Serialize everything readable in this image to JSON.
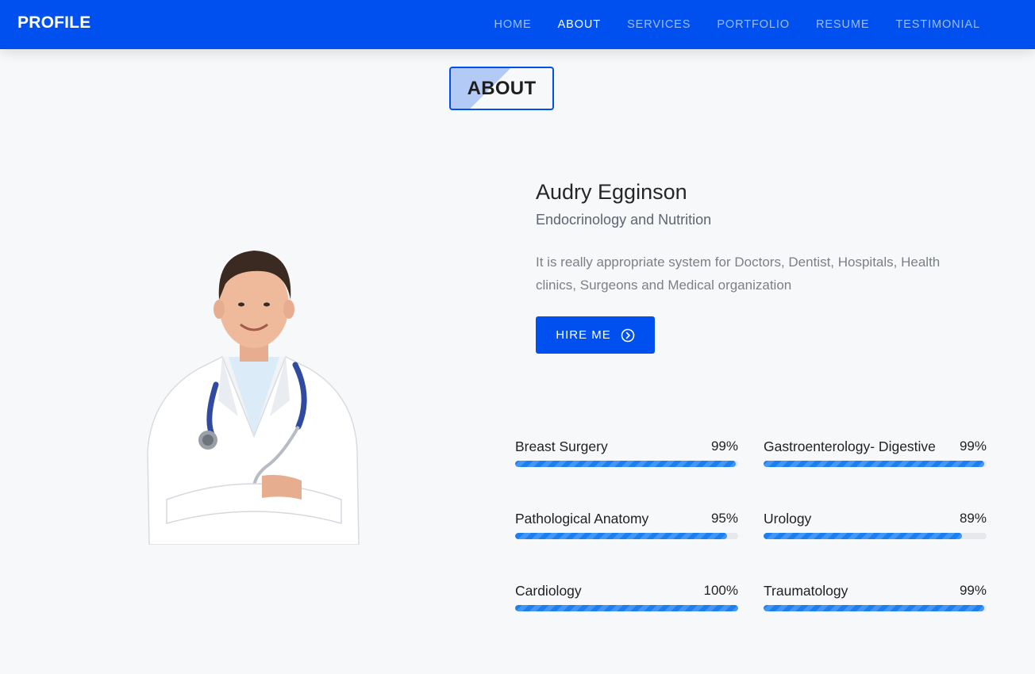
{
  "nav": {
    "brand": "PROFILE",
    "items": [
      {
        "label": "HOME",
        "active": false
      },
      {
        "label": "ABOUT",
        "active": true
      },
      {
        "label": "SERVICES",
        "active": false
      },
      {
        "label": "PORTFOLIO",
        "active": false
      },
      {
        "label": "RESUME",
        "active": false
      },
      {
        "label": "TESTIMONIAL",
        "active": false
      }
    ]
  },
  "section": {
    "title": "ABOUT"
  },
  "about": {
    "name": "Audry Egginson",
    "specialty": "Endocrinology and Nutrition",
    "description": "It is really appropriate system for Doctors, Dentist, Hospitals, Health clinics, Surgeons and Medical organization",
    "hire_label": "HIRE ME",
    "hire_icon": "arrow-right-circle-icon"
  },
  "skills": [
    {
      "label": "Breast Surgery",
      "percent_text": "99%",
      "value": 99
    },
    {
      "label": "Gastroenterology- Digestive",
      "percent_text": "99%",
      "value": 99
    },
    {
      "label": "Pathological Anatomy",
      "percent_text": "95%",
      "value": 95
    },
    {
      "label": "Urology",
      "percent_text": "89%",
      "value": 89
    },
    {
      "label": "Cardiology",
      "percent_text": "100%",
      "value": 100
    },
    {
      "label": "Traumatology",
      "percent_text": "99%",
      "value": 99
    }
  ],
  "colors": {
    "primary": "#0050ef",
    "progress": "#1a7ff0",
    "background": "#f7f8fa"
  }
}
